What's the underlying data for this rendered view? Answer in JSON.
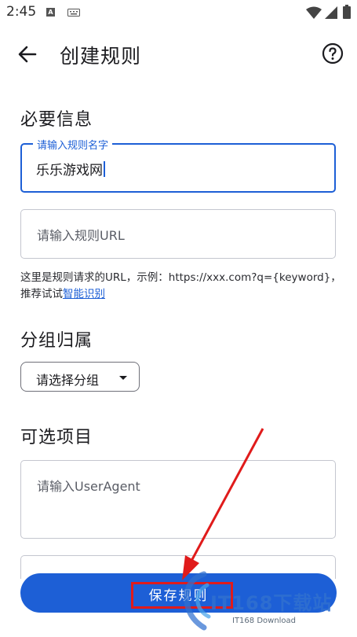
{
  "status_bar": {
    "time": "2:45",
    "icons": [
      "notification-a-icon",
      "keyboard-icon",
      "wifi-icon",
      "signal-icon",
      "battery-icon"
    ]
  },
  "app_bar": {
    "title": "创建规则",
    "back_icon": "arrow-left-icon",
    "help_icon": "help-circle-icon"
  },
  "required_section": {
    "title": "必要信息",
    "name_field": {
      "label": "请输入规则名字",
      "value": "乐乐游戏网"
    },
    "url_field": {
      "placeholder": "请输入规则URL"
    },
    "helper_text": "这里是规则请求的URL，示例：https://xxx.com?q={keyword}，推荐试试",
    "helper_link": "智能识别"
  },
  "group_section": {
    "title": "分组归属",
    "dropdown_label": "请选择分组"
  },
  "optional_section": {
    "title": "可选项目",
    "useragent_field": {
      "placeholder": "请输入UserAgent"
    }
  },
  "save_button": {
    "label": "保存规则"
  },
  "watermark": {
    "main": "IT168下载站",
    "sub": "IT168 Download"
  },
  "colors": {
    "primary": "#1d5fd6",
    "highlight": "#e01b1b"
  }
}
